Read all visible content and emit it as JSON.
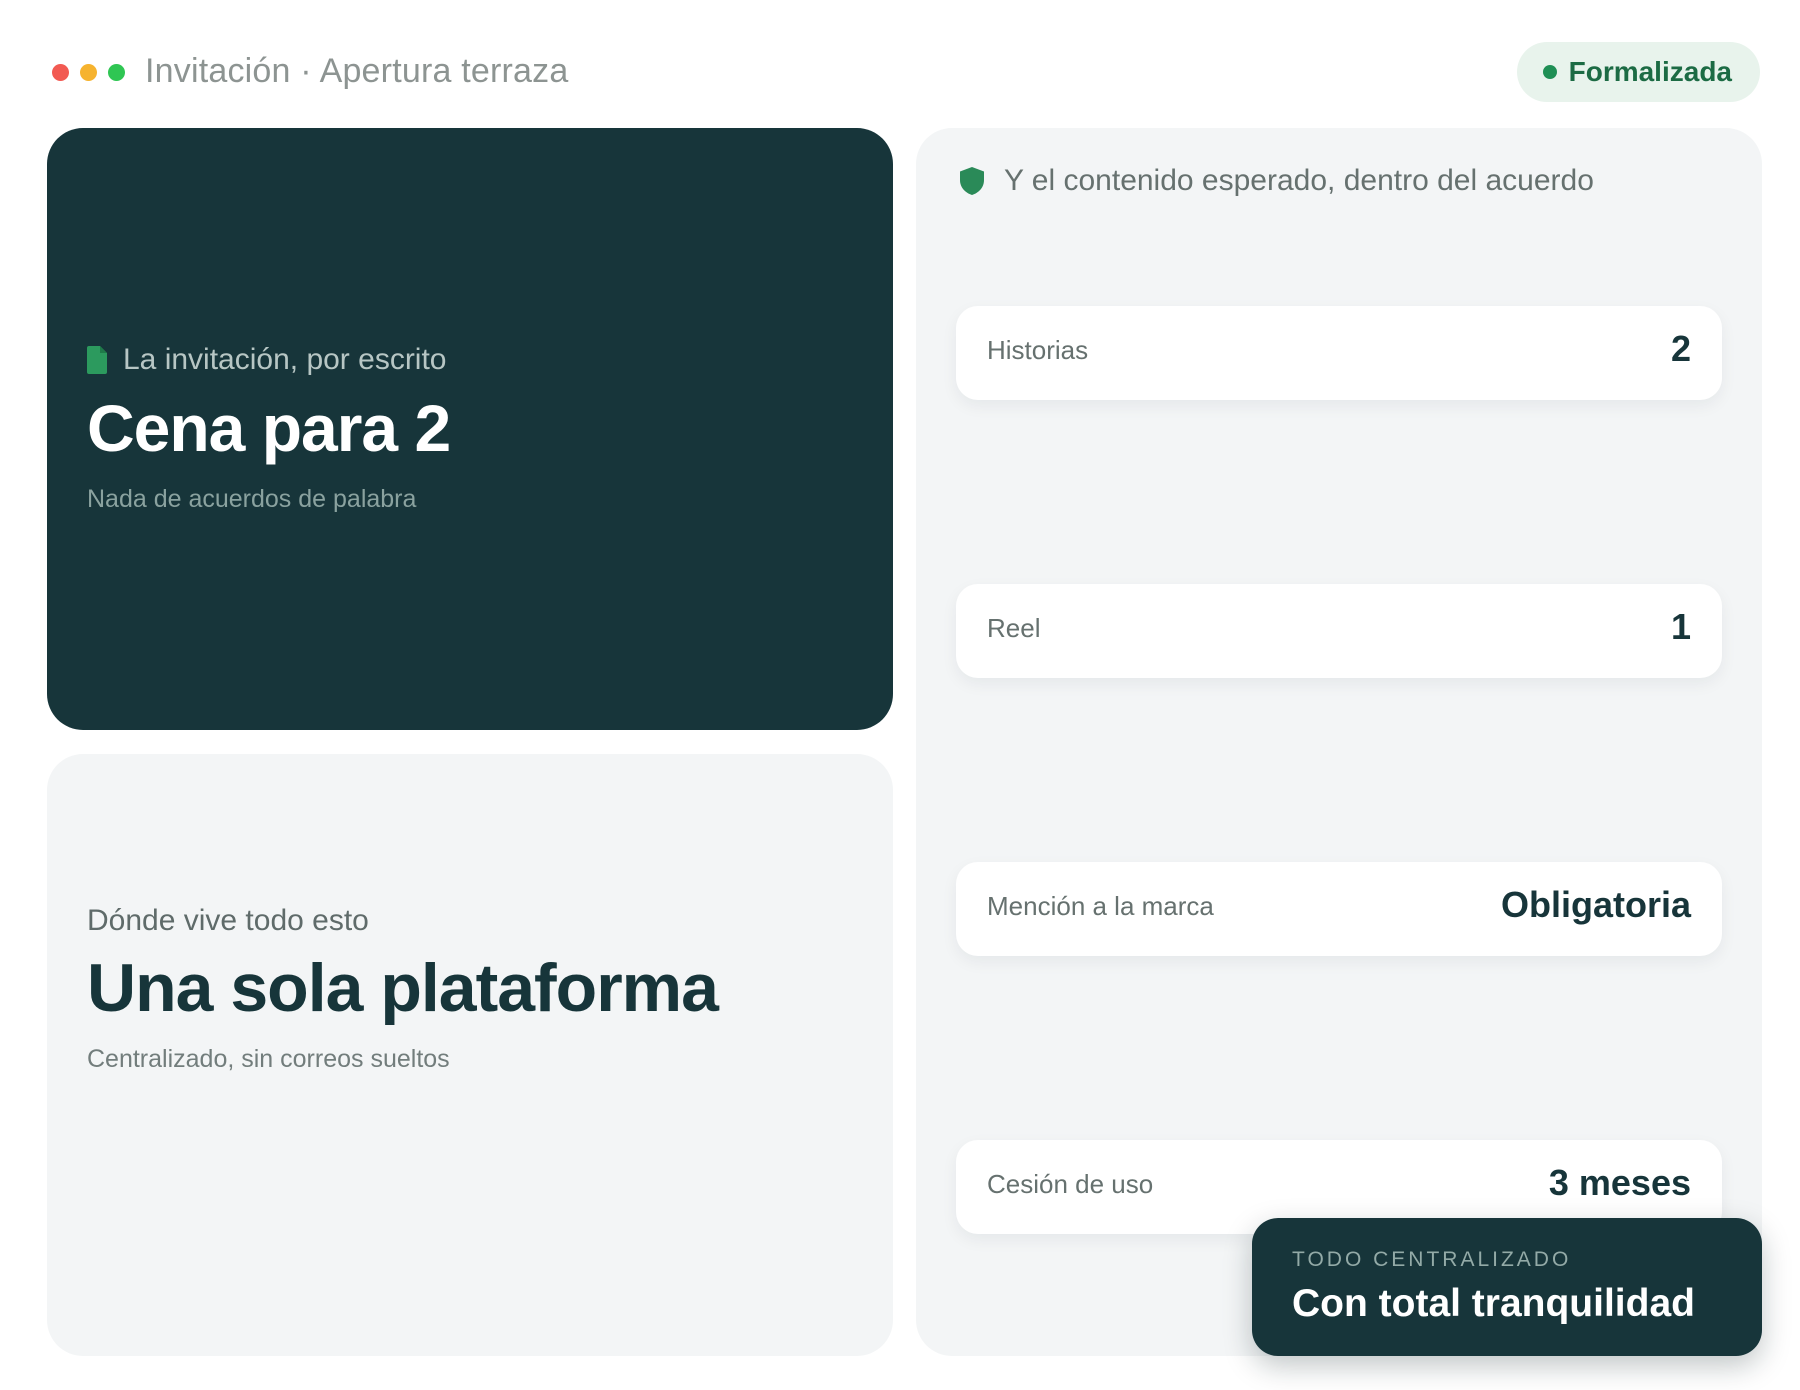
{
  "window": {
    "title": "Invitación · Apertura terraza",
    "traffic_lights": [
      "#f25a52",
      "#f6b32f",
      "#2fc653"
    ]
  },
  "status": {
    "label": "Formalizada",
    "dot_color": "#1f8f55",
    "text_color": "#1c6b44"
  },
  "invitation_card": {
    "icon": "document-icon",
    "kicker": "La invitación, por escrito",
    "headline": "Cena para 2",
    "subline": "Nada de acuerdos de palabra"
  },
  "platform_card": {
    "kicker": "Dónde vive todo esto",
    "headline": "Una sola plataforma",
    "subline": "Centralizado, sin correos sueltos"
  },
  "deliverables": {
    "icon": "shield-icon",
    "title": "Y el contenido esperado, dentro del acuerdo",
    "items": [
      {
        "label": "Historias",
        "value": "2"
      },
      {
        "label": "Reel",
        "value": "1"
      },
      {
        "label": "Mención a la marca",
        "value": "Obligatoria"
      },
      {
        "label": "Cesión de uso",
        "value": "3 meses"
      }
    ]
  },
  "toast": {
    "kicker": "TODO CENTRALIZADO",
    "title": "Con total tranquilidad"
  },
  "colors": {
    "accent_green": "#1f8f55",
    "dark_teal": "#17353a"
  }
}
